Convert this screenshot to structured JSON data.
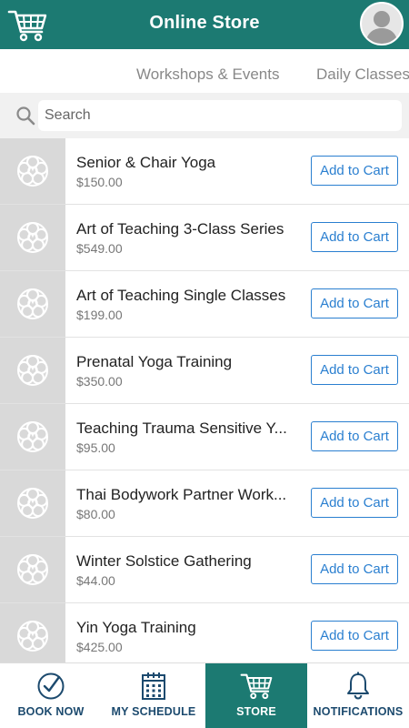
{
  "header": {
    "title": "Online Store",
    "cart_icon": "shopping-cart-icon",
    "avatar_icon": "user-avatar-icon"
  },
  "tabs": [
    {
      "label": "Workshops & Events"
    },
    {
      "label": "Daily Classes"
    }
  ],
  "search": {
    "placeholder": "Search",
    "value": ""
  },
  "products": [
    {
      "name": "Senior & Chair Yoga",
      "price": "$150.00",
      "button": "Add to Cart"
    },
    {
      "name": "Art of Teaching 3-Class Series",
      "price": "$549.00",
      "button": "Add to Cart"
    },
    {
      "name": "Art of Teaching Single Classes",
      "price": "$199.00",
      "button": "Add to Cart"
    },
    {
      "name": "Prenatal Yoga Training",
      "price": "$350.00",
      "button": "Add to Cart"
    },
    {
      "name": "Teaching Trauma Sensitive Y...",
      "price": "$95.00",
      "button": "Add to Cart"
    },
    {
      "name": "Thai Bodywork Partner Work...",
      "price": "$80.00",
      "button": "Add to Cart"
    },
    {
      "name": "Winter Solstice Gathering",
      "price": "$44.00",
      "button": "Add to Cart"
    },
    {
      "name": "Yin Yoga Training",
      "price": "$425.00",
      "button": "Add to Cart"
    }
  ],
  "nav": [
    {
      "label": "BOOK NOW",
      "icon": "checkmark-circle-icon"
    },
    {
      "label": "MY SCHEDULE",
      "icon": "calendar-icon"
    },
    {
      "label": "STORE",
      "icon": "shopping-cart-icon",
      "active": true
    },
    {
      "label": "NOTIFICATIONS",
      "icon": "bell-icon"
    }
  ],
  "colors": {
    "brand": "#1c7a72",
    "accent": "#2a7fd0",
    "nav_text": "#1c4a6e"
  }
}
